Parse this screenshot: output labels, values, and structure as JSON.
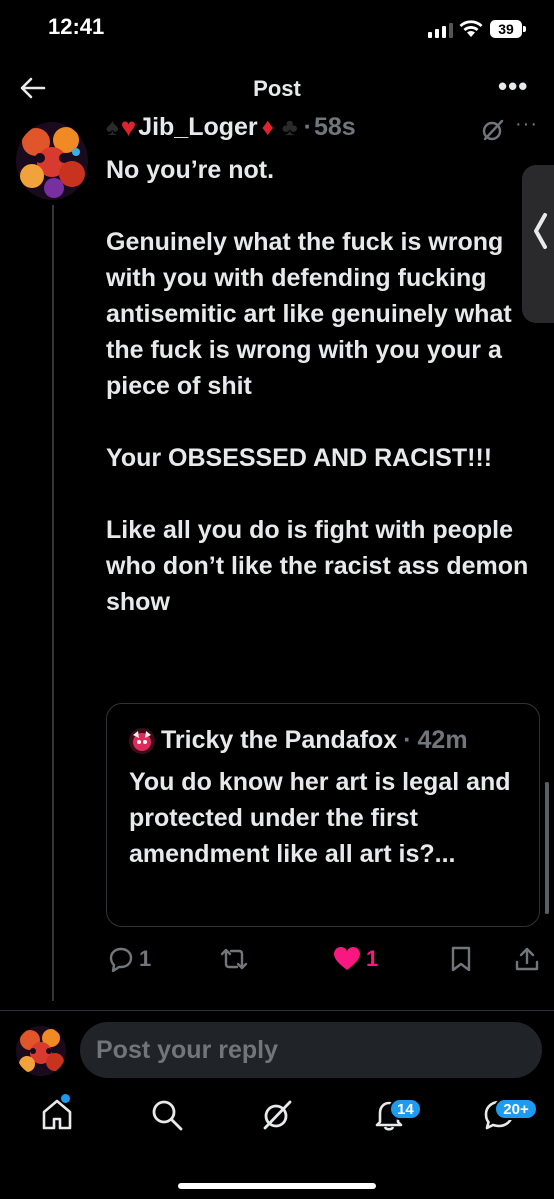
{
  "status_bar": {
    "time": "12:41",
    "battery": "39"
  },
  "header": {
    "title": "Post"
  },
  "post": {
    "author_name": "Jib_Loger",
    "separator": "·",
    "time": "58s",
    "text": "No you’re not.\n\nGenuinely what the fuck is wrong with you with defending fucking antisemitic art like genuinely what the fuck is wrong with you your a piece of shit\n\nYour OBSESSED AND RACIST!!!\n\nLike all you do is fight with people who don’t like the racist ass demon show",
    "quote": {
      "author_name": "Tricky the Pandafox",
      "separator": "·",
      "time": "42m",
      "text": "You do know her art is legal and protected under the first amendment like all art is?..."
    },
    "actions": {
      "reply_count": "1",
      "repost_count": "",
      "like_count": "1"
    }
  },
  "reply_box": {
    "placeholder": "Post your reply"
  },
  "tab_bar": {
    "notifications_badge": "14",
    "messages_badge": "20+"
  },
  "colors": {
    "background": "#000000",
    "text": "#e7e9ea",
    "muted": "#71767b",
    "like": "#f91880",
    "accent": "#1d9bf0"
  }
}
